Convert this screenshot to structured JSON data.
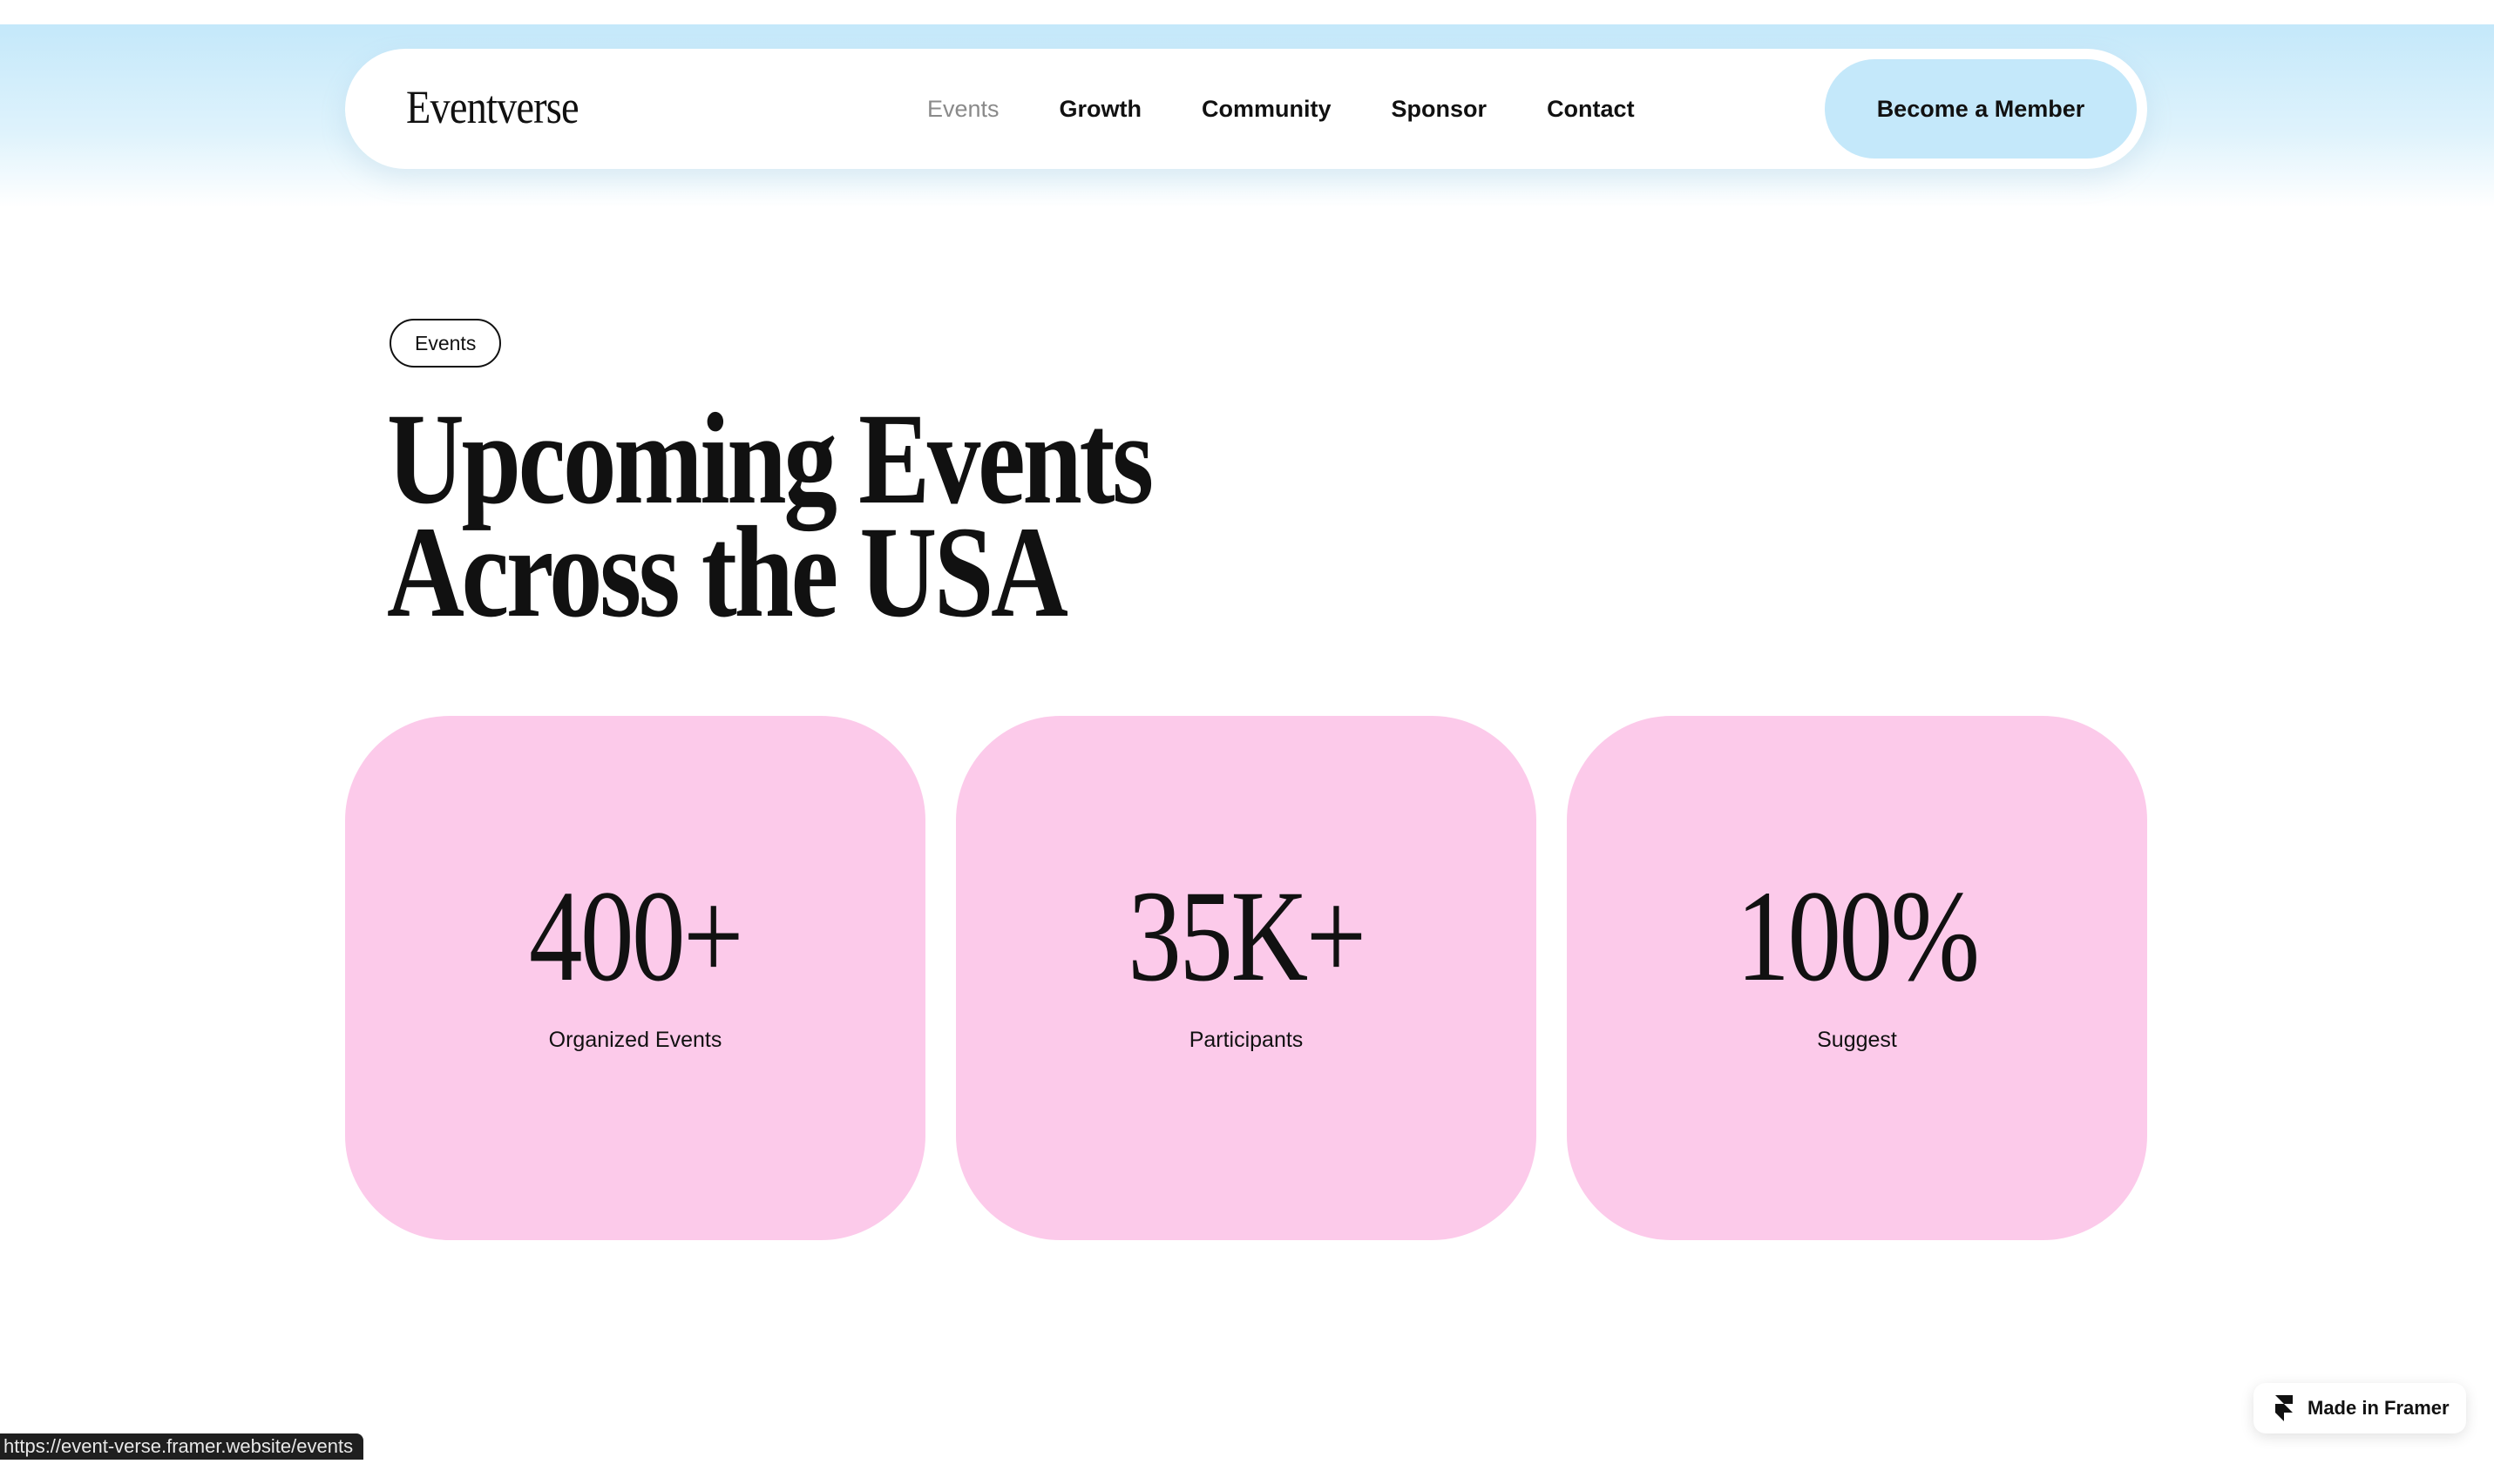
{
  "header": {
    "logo": "Eventverse",
    "nav": [
      "Events",
      "Growth",
      "Community",
      "Sponsor",
      "Contact"
    ],
    "active_nav": "Events",
    "cta_label": "Become a Member"
  },
  "hero": {
    "tag": "Events",
    "title_line1": "Upcoming Events",
    "title_line2": "Across the USA"
  },
  "stats": [
    {
      "value": "400+",
      "label": "Organized Events"
    },
    {
      "value": "35K+",
      "label": "Participants"
    },
    {
      "value": "100%",
      "label": "Suggest"
    }
  ],
  "status_bar": {
    "url": "https://event-verse.framer.website/events"
  },
  "badge": {
    "label": "Made in Framer",
    "icon": "framer-icon"
  },
  "colors": {
    "sky": "#c4e8fa",
    "card": "#fccaea",
    "text": "#111111"
  }
}
